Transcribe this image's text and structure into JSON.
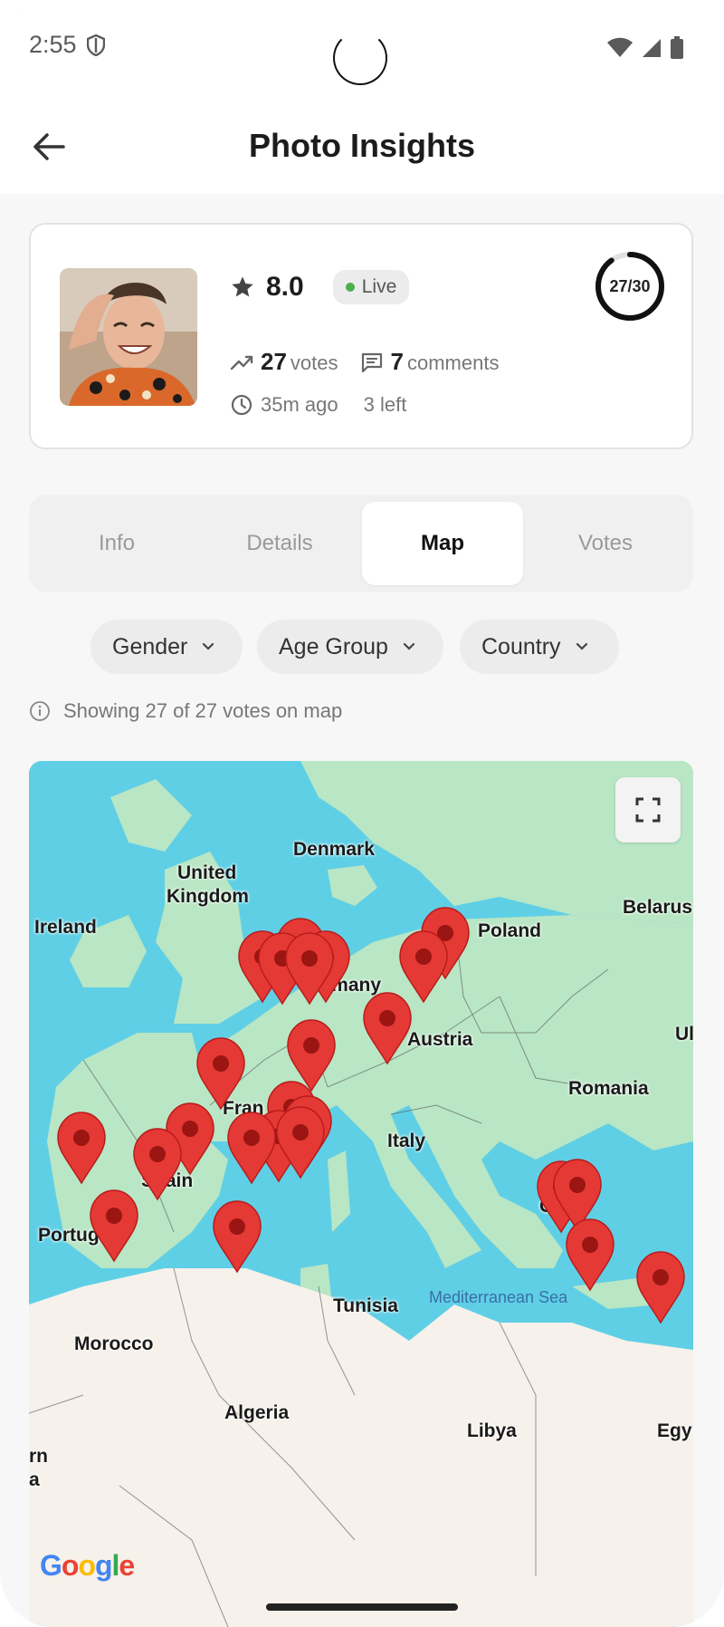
{
  "status": {
    "time": "2:55"
  },
  "header": {
    "title": "Photo Insights"
  },
  "summary": {
    "rating": "8.0",
    "live_label": "Live",
    "votes_count": "27",
    "votes_label": "votes",
    "comments_count": "7",
    "comments_label": "comments",
    "time_ago": "35m ago",
    "left_label": "3 left",
    "progress_text": "27/30",
    "progress_value": 0.9
  },
  "tabs": [
    {
      "label": "Info",
      "active": false
    },
    {
      "label": "Details",
      "active": false
    },
    {
      "label": "Map",
      "active": true
    },
    {
      "label": "Votes",
      "active": false
    }
  ],
  "filters": [
    {
      "label": "Gender"
    },
    {
      "label": "Age Group"
    },
    {
      "label": "Country"
    }
  ],
  "map_info": "Showing 27 of 27 votes on map",
  "map": {
    "labels": [
      "Denmark",
      "United",
      "Kingdom",
      "Belarus",
      "Ireland",
      "Poland",
      "rmany",
      "Ul",
      "Austria",
      "Fran",
      "Romania",
      "Italy",
      "Spain",
      "Gre",
      "Portugal",
      "Tunisia",
      "Morocco",
      "Algeria",
      "Libya",
      "Egyp",
      "rn",
      "a"
    ],
    "sea_label": "Mediterranean Sea",
    "google": "Google"
  },
  "colors": {
    "accent": "#e53935",
    "live": "#4caf50",
    "sea": "#5fcfe6",
    "land": "#b9e6c4",
    "desert": "#f6f1ea"
  }
}
